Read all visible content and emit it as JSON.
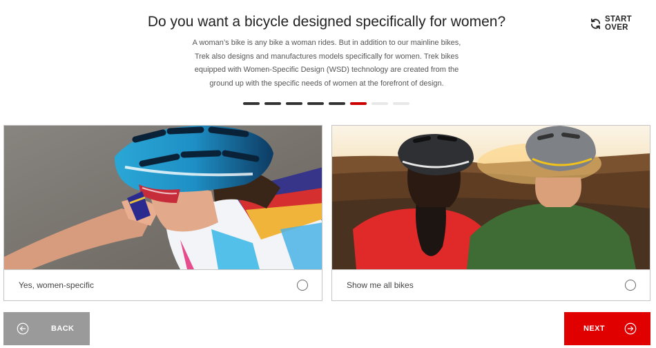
{
  "question": {
    "title": "Do you want a bicycle designed specifically for women?",
    "description": "A woman’s bike is any bike a woman rides. But in addition to our mainline bikes, Trek also designs and manufactures models specifically for women. Trek bikes equipped with Women-Specific Design (WSD) technology are created from the ground up with the specific needs of women at the forefront of design."
  },
  "start_over": {
    "label": "START OVER",
    "icon": "refresh-icon"
  },
  "progress": {
    "total_steps": 8,
    "current_step": 6,
    "done_color": "#333333",
    "current_color": "#cc0000",
    "todo_color": "#e8e8e8"
  },
  "options": [
    {
      "label": "Yes, women-specific",
      "selected": false,
      "image": "woman cyclist with blue helmet"
    },
    {
      "label": "Show me all bikes",
      "selected": false,
      "image": "two riders with helmets at sunset"
    }
  ],
  "nav": {
    "back_label": "BACK",
    "next_label": "NEXT",
    "back_color": "#9a9a9a",
    "next_color": "#e10000"
  }
}
